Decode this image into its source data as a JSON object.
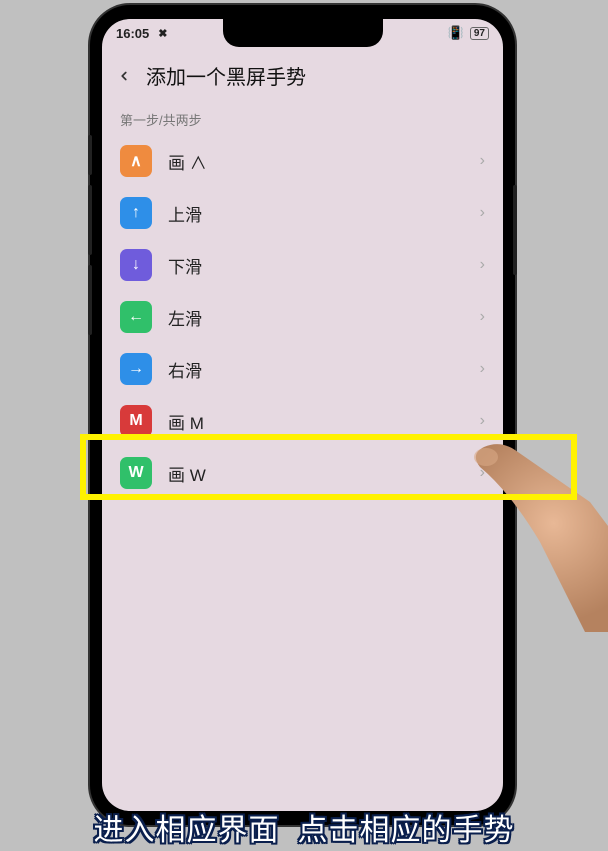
{
  "status": {
    "time": "16:05",
    "battery": "97"
  },
  "header": {
    "title": "添加一个黑屏手势"
  },
  "step_hint": "第一步/共两步",
  "items": [
    {
      "label": "画 ∧",
      "icon": "∧",
      "bg": "#ef8b3f"
    },
    {
      "label": "上滑",
      "icon": "↑",
      "bg": "#2e8fe8"
    },
    {
      "label": "下滑",
      "icon": "↓",
      "bg": "#6f5cdc"
    },
    {
      "label": "左滑",
      "icon": "←",
      "bg": "#30c06a"
    },
    {
      "label": "右滑",
      "icon": "→",
      "bg": "#2e8fe8"
    },
    {
      "label": "画 M",
      "icon": "M",
      "bg": "#d83a3a"
    },
    {
      "label": "画 W",
      "icon": "W",
      "bg": "#30c06a"
    }
  ],
  "subtitle": {
    "a": "进入相应界面",
    "b": "点击相应的手势"
  }
}
